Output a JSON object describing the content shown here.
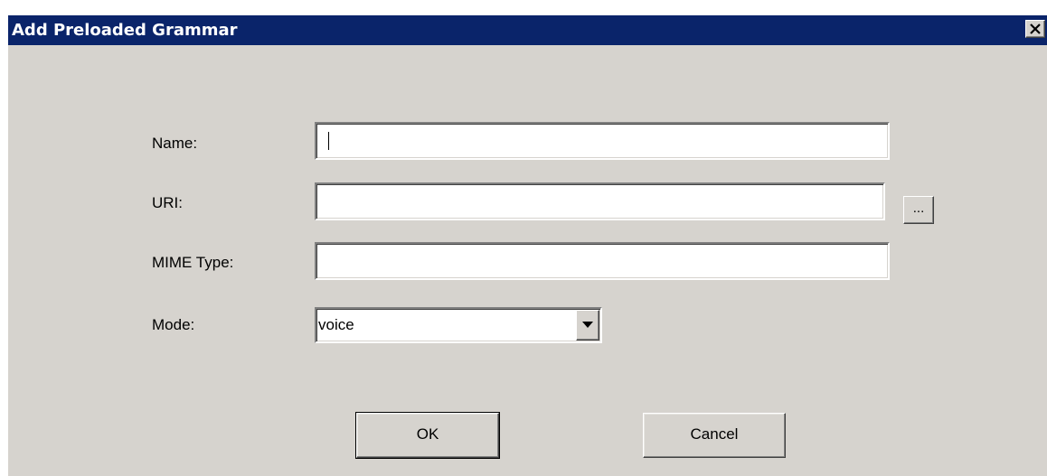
{
  "dialog": {
    "title": "Add Preloaded Grammar",
    "close_label": "×"
  },
  "form": {
    "name_label": "Name:",
    "name_value": "",
    "uri_label": "URI:",
    "uri_value": "",
    "browse_label": "...",
    "mime_label": "MIME Type:",
    "mime_value": "",
    "mode_label": "Mode:",
    "mode_value": "voice"
  },
  "buttons": {
    "ok_label": "OK",
    "cancel_label": "Cancel"
  },
  "colors": {
    "titlebar": "#0a246a",
    "dialog_bg": "#d6d3ce",
    "field_bg": "#ffffff"
  },
  "icons": {
    "close": "close-icon",
    "dropdown": "chevron-down-icon"
  }
}
